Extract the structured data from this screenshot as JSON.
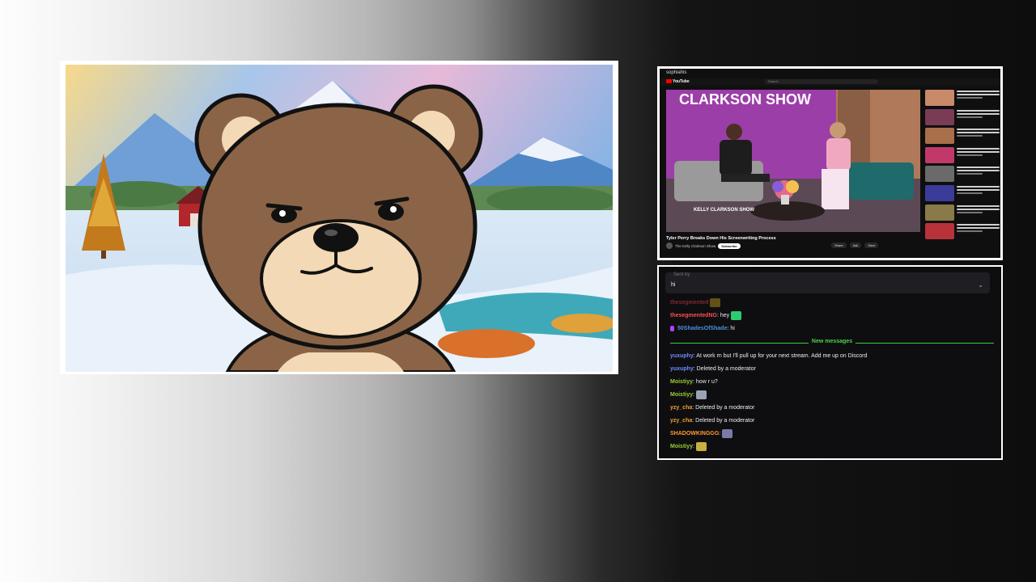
{
  "youtube": {
    "channel_label": "sophiahis",
    "logo_text": "YouTube",
    "search_placeholder": "Search",
    "video_title": "Tyler Perry Breaks Down His Screenwriting Process",
    "channel_name": "The Kelly Clarkson Show",
    "subscribe_label": "Subscribe",
    "actions": [
      "Share",
      "Ask",
      "Save"
    ],
    "show_logo_text": "CLARKSON SHOW",
    "show_bug_text": "KELLY CLARKSON SHOW"
  },
  "chat": {
    "reply_faded_text": "Sent by",
    "reply_input": "hi",
    "collapse_icon": "chevron-down-icon",
    "new_messages_label": "New messages",
    "colors": {
      "divider": "#3cc93c",
      "chat_bg": "#0e0e10"
    },
    "messages_before": [
      {
        "user": "thesegmented",
        "text": "",
        "color": "#ff4d4d",
        "emote": "#c8a020",
        "faded": true
      },
      {
        "user": "thesegmentedNG",
        "text": ": hey",
        "color": "#ff4d4d",
        "emote": "#2ecc71"
      },
      {
        "user": "50ShadesOfShade",
        "text": ": hi",
        "color": "#4a90e2",
        "badge": true
      }
    ],
    "messages_after": [
      {
        "user": "yuxuphy",
        "text": ": At work rn but I'll pull up for your next stream. Add me up on Discord",
        "color": "#6b8cff"
      },
      {
        "user": "yuxuphy",
        "text": ": Deleted by a moderator",
        "color": "#6b8cff"
      },
      {
        "user": "Moistiyy",
        "text": ": how r u?",
        "color": "#9acd32"
      },
      {
        "user": "Moistiyy",
        "text": ":",
        "color": "#9acd32",
        "emote": "#9aa3b5"
      },
      {
        "user": "yzy_cha",
        "text": ": Deleted by a moderator",
        "color": "#f0a030"
      },
      {
        "user": "yzy_cha",
        "text": ": Deleted by a moderator",
        "color": "#f0a030"
      },
      {
        "user": "SHADOWKINGGG",
        "text": ":",
        "color": "#ff9933",
        "emote": "#7a7aa8"
      },
      {
        "user": "Moistiyy",
        "text": ":",
        "color": "#9acd32",
        "emote": "#c8b040"
      }
    ]
  }
}
